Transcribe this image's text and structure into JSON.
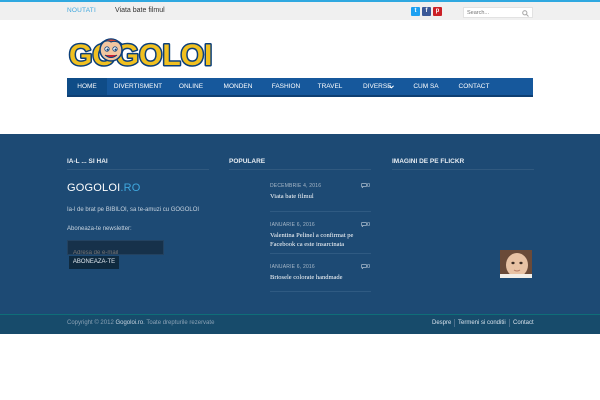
{
  "topbar": {
    "label": "NOUTATI",
    "ticker": "Viata bate filmul",
    "search_placeholder": "Search..."
  },
  "social": [
    {
      "icon": "twitter-icon",
      "glyph": "t",
      "color": "#1da1f2"
    },
    {
      "icon": "facebook-icon",
      "glyph": "f",
      "color": "#3b5998"
    },
    {
      "icon": "pinterest-icon",
      "glyph": "p",
      "color": "#cb2027"
    }
  ],
  "logo": {
    "text": "GOGOLOI"
  },
  "nav": {
    "items": [
      "HOME",
      "DIVERTISMENT",
      "ONLINE",
      "MONDEN",
      "FASHION",
      "TRAVEL",
      "DIVERSE",
      "CUM SA",
      "CONTACT"
    ],
    "active": "HOME",
    "accent": "#16589c"
  },
  "widget_about": {
    "title": "IA-L ... SI HAI",
    "brand_main": "GOGOLOI",
    "brand_tld": ".RO",
    "text": "Ia-l de brat pe BIBILOI, sa te-amuzi cu GOGOLOI",
    "newsletter_label": "Aboneaza-te newsletter:",
    "email_placeholder": "Adresa de e-mail",
    "subscribe_label": "ABONEAZA-TE"
  },
  "widget_popular": {
    "title": "POPULARE",
    "posts": [
      {
        "date": "DECEMBRIE 4, 2016",
        "comments": "0",
        "title": "Viata bate filmul"
      },
      {
        "date": "IANUARIE 6, 2016",
        "comments": "0",
        "title": "Valentina Pelinel a confirmat pe Facebook ca este insarcinata"
      },
      {
        "date": "IANUARIE 6, 2016",
        "comments": "0",
        "title": "Briosele colorate handmade"
      }
    ]
  },
  "widget_flickr": {
    "title": "IMAGINI DE PE FLICKR"
  },
  "footer": {
    "copyright_prefix": "Copyright © 2012",
    "site": "Gogoloi.ro",
    "copyright_suffix": ". Toate drepturile rezervate",
    "links": [
      "Despre",
      "Termeni si conditii",
      "Contact"
    ]
  }
}
